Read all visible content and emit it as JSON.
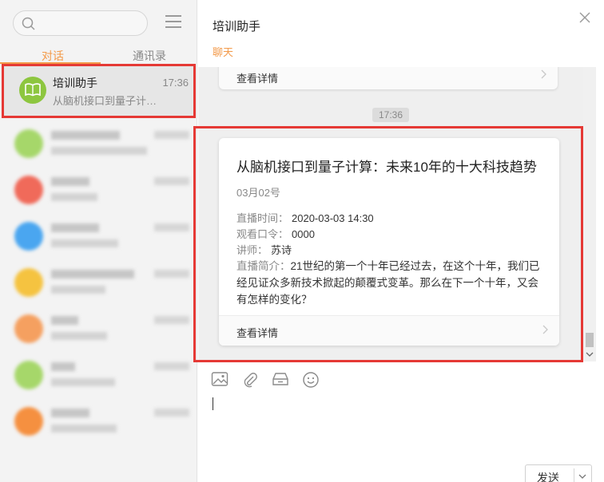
{
  "sidebar": {
    "tabs": [
      {
        "label": "对话"
      },
      {
        "label": "通讯录"
      }
    ],
    "active_conversation": {
      "name": "培训助手",
      "time": "17:36",
      "preview": "从脑机接口到量子计…",
      "avatar_icon": "book-icon",
      "avatar_color": "#8dc63f"
    },
    "blurred_avatar_colors": [
      "#a6d76a",
      "#f06a5a",
      "#4aa6f0",
      "#f5c340",
      "#f5a060",
      "#a6d76a",
      "#f59040"
    ]
  },
  "chat": {
    "title": "培训助手",
    "tab_label": "聊天",
    "previous_card_detail": "查看详情",
    "timestamp": "17:36",
    "card": {
      "title": "从脑机接口到量子计算：未来10年的十大科技趋势",
      "date": "03月02号",
      "live_time_key": "直播时间：",
      "live_time_value": "2020-03-03 14:30",
      "watch_code_key": "观看口令：",
      "watch_code_value": "0000",
      "lecturer_key": "讲师：",
      "lecturer_value": "苏诗",
      "intro_key": "直播简介：",
      "intro_value": "21世纪的第一个十年已经过去，在这个十年，我们已经见证众多新技术掀起的颠覆式变革。那么在下一个十年，又会有怎样的变化？",
      "detail_label": "查看详情"
    },
    "toolbar_icons": [
      "image-icon",
      "attachment-icon",
      "folder-icon",
      "emoji-icon"
    ],
    "send_label": "发送"
  },
  "colors": {
    "accent": "#f39a4a",
    "highlight": "#e53935"
  }
}
